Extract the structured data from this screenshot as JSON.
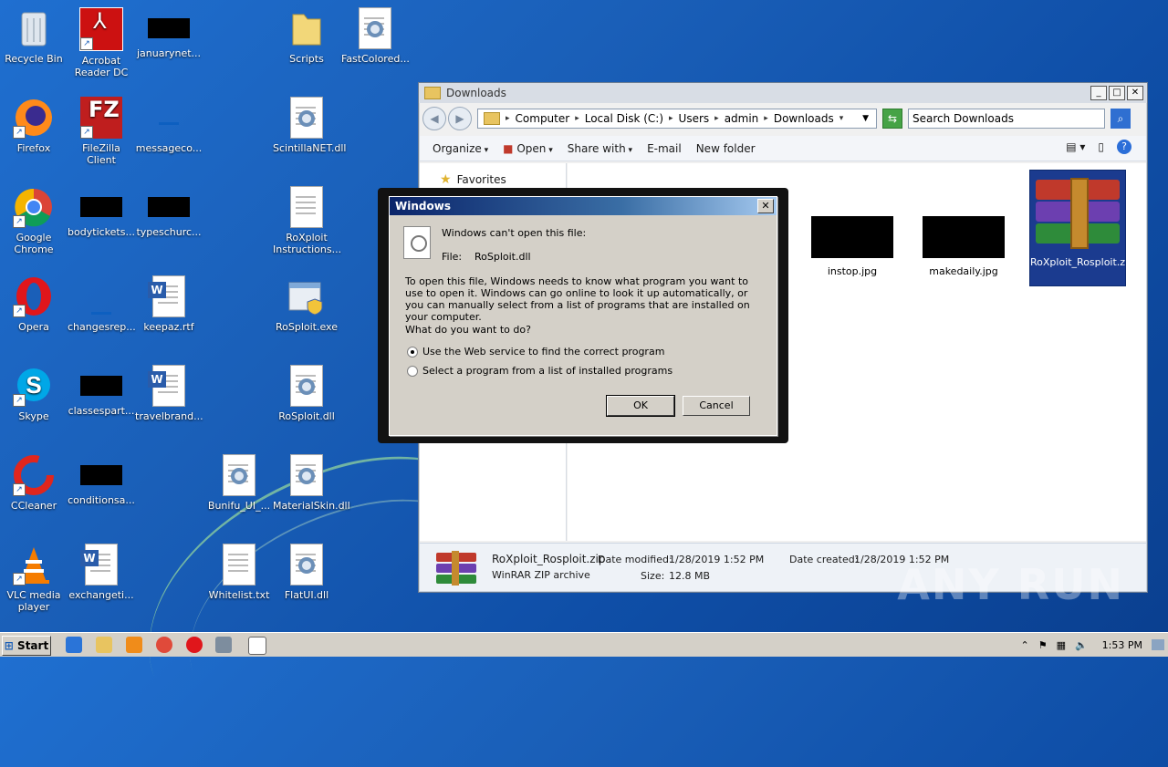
{
  "desktop": {
    "icons": [
      {
        "label": "Recycle Bin"
      },
      {
        "label": "Acrobat Reader DC"
      },
      {
        "label": "januarynet..."
      },
      {
        "label": "Scripts"
      },
      {
        "label": "FastColored..."
      },
      {
        "label": "Firefox"
      },
      {
        "label": "FileZilla Client"
      },
      {
        "label": "messageco..."
      },
      {
        "label": "ScintillaNET.dll"
      },
      {
        "label": "Google Chrome"
      },
      {
        "label": "bodytickets..."
      },
      {
        "label": "typeschurc..."
      },
      {
        "label": "RoXploit Instructions..."
      },
      {
        "label": "Opera"
      },
      {
        "label": "changesrep..."
      },
      {
        "label": "keepaz.rtf"
      },
      {
        "label": "RoSploit.exe"
      },
      {
        "label": "Skype"
      },
      {
        "label": "classespart..."
      },
      {
        "label": "travelbrand..."
      },
      {
        "label": "RoSploit.dll"
      },
      {
        "label": "CCleaner"
      },
      {
        "label": "conditionsa..."
      },
      {
        "label": "Bunifu_UI_..."
      },
      {
        "label": "MaterialSkin.dll"
      },
      {
        "label": "VLC media player"
      },
      {
        "label": "exchangeti..."
      },
      {
        "label": "Whitelist.txt"
      },
      {
        "label": "FlatUI.dll"
      }
    ]
  },
  "explorer": {
    "title": "Downloads",
    "address": [
      "Computer",
      "Local Disk (C:)",
      "Users",
      "admin",
      "Downloads"
    ],
    "search_placeholder": "Search Downloads",
    "commands": {
      "organize": "Organize",
      "open": "Open",
      "share": "Share with",
      "email": "E-mail",
      "newfolder": "New folder"
    },
    "nav": {
      "favorites": "Favorites"
    },
    "files": [
      {
        "name": "instop.jpg"
      },
      {
        "name": "makedaily.jpg"
      },
      {
        "name": "RoXploit_Rosploit.zip"
      }
    ],
    "details": {
      "name": "RoXploit_Rosploit.zip",
      "type": "WinRAR ZIP archive",
      "modified_label": "Date modified:",
      "modified": "1/28/2019 1:52 PM",
      "size_label": "Size:",
      "size": "12.8 MB",
      "created_label": "Date created:",
      "created": "1/28/2019 1:52 PM"
    }
  },
  "dialog": {
    "title": "Windows",
    "headline": "Windows can't open this file:",
    "file_label": "File:",
    "file_name": "RoSploit.dll",
    "explanation": "To open this file, Windows needs to know what program you want to use to open it. Windows can go online to look it up automatically, or you can manually select from a list of programs that are installed on your computer.",
    "question": "What do you want to do?",
    "option_web": "Use the Web service to find the correct program",
    "option_list": "Select a program from a list of installed programs",
    "ok": "OK",
    "cancel": "Cancel"
  },
  "taskbar": {
    "start": "Start",
    "clock": "1:53 PM"
  },
  "watermark": "ANY RUN"
}
